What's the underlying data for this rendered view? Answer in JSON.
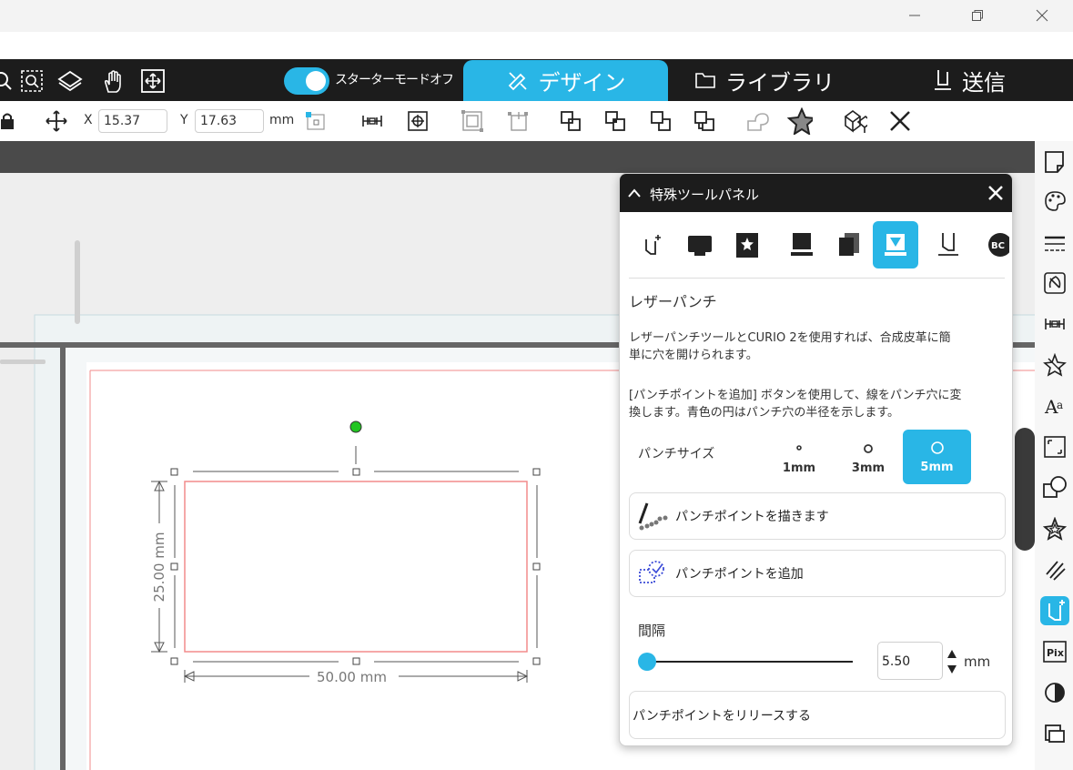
{
  "window": {
    "minimize_glyph": "—",
    "maximize_glyph": "❐",
    "close_glyph": "✕"
  },
  "toolbar": {
    "starter_mode_label": "スターターモードオフ",
    "tabs": [
      {
        "label": "デザイン",
        "icon": "design-icon",
        "active": true
      },
      {
        "label": "ライブラリ",
        "icon": "folder-icon",
        "active": false
      },
      {
        "label": "送信",
        "icon": "send-icon",
        "active": false
      }
    ]
  },
  "subtoolbar": {
    "x_label": "X",
    "x_value": "15.37",
    "y_label": "Y",
    "y_value": "17.63",
    "unit": "mm"
  },
  "canvas": {
    "width_dim": "50.00 mm",
    "height_dim": "25.00 mm"
  },
  "panel": {
    "title": "特殊ツールパネル",
    "section_title": "レザーパンチ",
    "desc1_line1": "レザーパンチツールとCURIO 2を使用すれば、合成皮革に簡",
    "desc1_line2": "単に穴を開けられます。",
    "desc2_line1": "[パンチポイントを追加] ボタンを使用して、線をパンチ穴に変",
    "desc2_line2": "換します。青色の円はパンチ穴の半径を示します。",
    "punch_size_label": "パンチサイズ",
    "sizes": [
      {
        "label": "1mm",
        "selected": false
      },
      {
        "label": "3mm",
        "selected": false
      },
      {
        "label": "5mm",
        "selected": true
      }
    ],
    "draw_button": "パンチポイントを描きます",
    "add_button": "パンチポイントを追加",
    "interval_label": "間隔",
    "interval_value": "5.50",
    "interval_unit": "mm",
    "release_button": "パンチポイントをリリースする",
    "interval_slider_position": 0
  },
  "colors": {
    "accent": "#29b6e6",
    "dark_bar": "#1c1c1c",
    "cut_line": "#f28b8b",
    "handle_rotate": "#22c522"
  }
}
